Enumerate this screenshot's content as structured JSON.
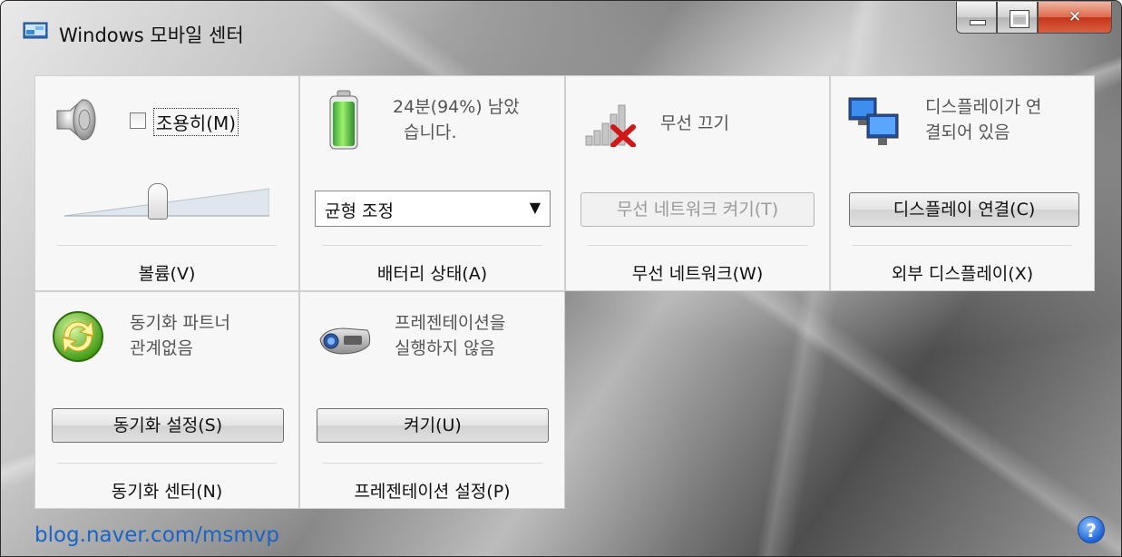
{
  "window": {
    "title": "Windows 모바일 센터"
  },
  "volume": {
    "mute_label": "조용히(M)",
    "mute_checked": false,
    "level_percent": 45,
    "tile_label": "볼륨(V)"
  },
  "battery": {
    "status": "24분(94%) 남았습니다.",
    "status_line1": "24분(94%) 남았",
    "status_line2": "습니다.",
    "plan_selected": "균형 조정",
    "tile_label": "배터리 상태(A)"
  },
  "wireless": {
    "status": "무선 끄기",
    "button_label": "무선 네트워크 켜기(T)",
    "tile_label": "무선 네트워크(W)"
  },
  "display": {
    "status_line1": "디스플레이가 연",
    "status_line2": "결되어 있음",
    "button_label": "디스플레이 연결(C)",
    "tile_label": "외부 디스플레이(X)"
  },
  "sync": {
    "status_line1": "동기화 파트너",
    "status_line2": "관계없음",
    "button_label": "동기화 설정(S)",
    "tile_label": "동기화 센터(N)"
  },
  "presentation": {
    "status_line1": "프레젠테이션을",
    "status_line2": "실행하지 않음",
    "button_label": "켜기(U)",
    "tile_label": "프레젠테이션 설정(P)"
  },
  "footer": {
    "watermark": "blog.naver.com/msmvp"
  },
  "help": {
    "glyph": "?"
  },
  "icons": {
    "speaker": "speaker-icon",
    "battery": "battery-icon",
    "wireless": "wireless-off-icon",
    "display": "monitors-icon",
    "sync": "sync-icon",
    "projector": "projector-icon",
    "help": "help-icon"
  }
}
